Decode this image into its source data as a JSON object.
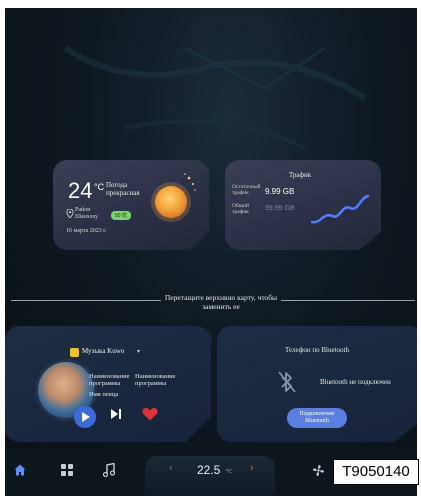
{
  "weather": {
    "temperature": "24",
    "unit": "°C",
    "condition": "Погода прекрасная",
    "location": "Район Шанхэ­ху",
    "aqi": "50 优",
    "date": "16 марта 2023 г."
  },
  "traffic": {
    "title": "Трафик",
    "remaining_label": "Остаточный трафик",
    "remaining_value": "9.99 GB",
    "total_label": "Общий трафик",
    "total_value": "99.99 GB"
  },
  "hint": "Перетащите верхнюю карту, чтобы заменить ее",
  "music": {
    "app_name": "Музыка Kuwo",
    "program_1": "Наименование программы",
    "program_2": "Наименование программы",
    "singer": "Имя певца"
  },
  "bluetooth": {
    "title": "Телефон по Bluetooth",
    "status": "Bluetooth не подключен",
    "connect_label": "Подключение Bluetooth"
  },
  "bottom_bar": {
    "climate_temp": "22.5",
    "climate_unit": "°C",
    "left_arrow": "‹",
    "right_arrow": "›",
    "label": "T9050140"
  },
  "colors": {
    "accent_blue": "#3d6ad8",
    "heart_red": "#e0323c",
    "aqi_green": "#7fd36e"
  }
}
